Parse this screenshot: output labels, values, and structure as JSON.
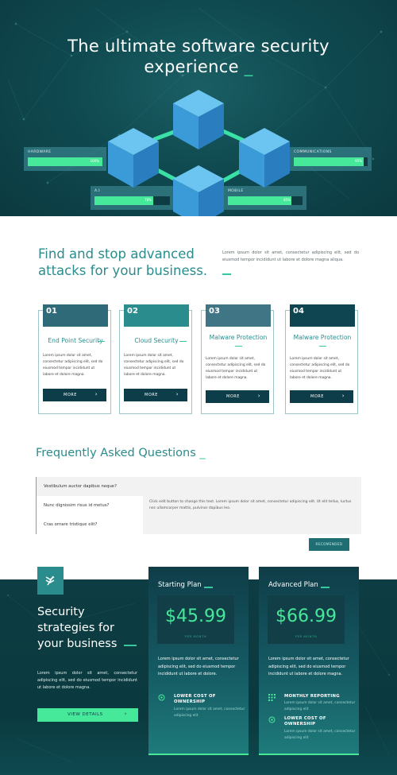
{
  "hero": {
    "title_line1": "The ultimate software security",
    "title_line2": "experience",
    "underscore": "_",
    "stats": [
      {
        "label": "HARDWARE",
        "value": 100,
        "text": "100%"
      },
      {
        "label": "COMMUNICATIONS",
        "value": 95,
        "text": "95%"
      },
      {
        "label": "A.I",
        "value": 78,
        "text": "78%"
      },
      {
        "label": "MOBILE",
        "value": 85,
        "text": "85%"
      }
    ],
    "colors": {
      "accent": "#46e89a",
      "cube": "#3a9bd8",
      "bg": "#0f4a50"
    }
  },
  "feature": {
    "title_line1": "Find and stop advanced",
    "title_line2": "attacks for your business.",
    "text": "Lorem ipsum dolor sit amet, consectetur adipiscing elit, sed do eiusmod tempor incididunt ut labore et dolore magna aliqua."
  },
  "cards": [
    {
      "num": "01",
      "title": "End Point Security",
      "text": "Lorem ipsum dolor sit amet, consectetur adipiscing elit, sed do eiusmod tempor incididunt ut labore et dolore magna.",
      "button": "MORE",
      "color": "#2f6a78"
    },
    {
      "num": "02",
      "title": "Cloud Security",
      "text": "Lorem ipsum dolor sit amet, consectetur adipiscing elit, sed do eiusmod tempor incididunt ut labore et dolore magna.",
      "button": "MORE",
      "color": "#2a8c8d"
    },
    {
      "num": "03",
      "title": "Malware Protection",
      "text": "Lorem ipsum dolor sit amet, consectetur adipiscing elit, sed do eiusmod tempor incididunt ut labore et dolore magna.",
      "button": "MORE",
      "color": "#3f7585"
    },
    {
      "num": "04",
      "title": "Malware Protection",
      "text": "Lorem ipsum dolor sit amet, consectetur adipiscing elit, sed do eiusmod tempor incididunt ut labore et dolore magna.",
      "button": "MORE",
      "color": "#0f4550"
    }
  ],
  "faq": {
    "title": "Frequently Asked Questions",
    "underscore": "_",
    "questions": [
      "Vestibulum auctor dapibus neque?",
      "Nunc dignissim risus id metus?",
      "Cras ornare tristique elit?"
    ],
    "answer": "Click edit button to change this text. Lorem ipsum dolor sit amet, consectetur adipiscing elit. Ut elit tellus, luctus nec ullamcorper mattis, pulvinar dapibus leo.",
    "button": "RECOMENDED"
  },
  "security": {
    "title_line1": "Security",
    "title_line2": "strategies for",
    "title_line3": "your business",
    "text": "Lorem ipsum dolor sit amet, consectetur adipiscing elit, sed do eiusmod tempor incididunt ut labore et dolore magna.",
    "button": "VIEW DETAILS"
  },
  "plans": [
    {
      "name": "Starting Plan",
      "price": "$45.99",
      "per": "PER MONTH",
      "desc": "Lorem ipsum dolor sit amet, consectetur adipiscing elit, sed do eiusmod tempor incididunt ut labore et dolore.",
      "features": [
        {
          "name": "LOWER COST OF OWNERSHIP",
          "sub": "Lorem ipsum dolor sit amet, consectetur adipiscing elit",
          "icon": "target-icon"
        }
      ]
    },
    {
      "name": "Advanced Plan",
      "price": "$66.99",
      "per": "PER MONTH",
      "desc": "Lorem ipsum dolor sit amet, consectetur adipiscing elit, sed do eiusmod tempor incididunt ut labore et dolore magna.",
      "features": [
        {
          "name": "MONTHLY REPORTING",
          "sub": "Lorem ipsum dolor sit amet, consectetur adipiscing elit",
          "icon": "grid-icon"
        },
        {
          "name": "LOWER COST OF OWNERSHIP",
          "sub": "Lorem ipsum dolor sit amet, consectetur adipiscing elit",
          "icon": "target-icon"
        }
      ]
    }
  ]
}
